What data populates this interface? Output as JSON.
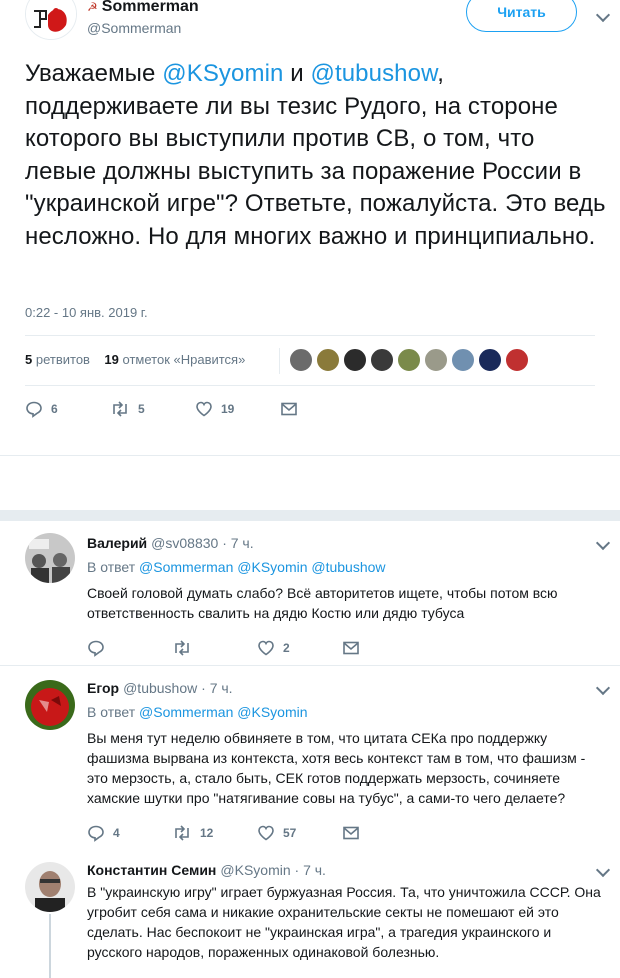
{
  "main": {
    "name": "Sommerman",
    "name_icon": "☭",
    "handle": "@Sommerman",
    "follow_label": "Читать",
    "text_parts": {
      "p1": "Уважаемые ",
      "m1": "@KSyomin",
      "p2": " и ",
      "m2": "@tubushow",
      "p3": ", поддерживаете ли вы тезис Рудого, на стороне которого вы выступили против СВ, о том, что левые должны выступить за поражение России в \"украинской игре\"? Ответьте, пожалуйста. Это ведь несложно. Но для многих важно и принципиально."
    },
    "timestamp": "0:22 - 10 янв. 2019 г.",
    "retweets_count": "5",
    "retweets_label": "ретвитов",
    "likes_count": "19",
    "likes_label": "отметок «Нравится»",
    "liker_colors": [
      "#6b6b6b",
      "#8a7a3a",
      "#2b2b2b",
      "#3a3a3a",
      "#7a8a4a",
      "#9a9a8a",
      "#7090b0",
      "#1a2a5a",
      "#c03030"
    ],
    "actions": {
      "replies": "6",
      "retweets": "5",
      "likes": "19"
    }
  },
  "replies": [
    {
      "name": "Валерий",
      "handle": "@sv08830",
      "time": "· 7 ч.",
      "in_reply_label": "В ответ",
      "in_reply_mentions": "@Sommerman @KSyomin @tubushow",
      "text": "Своей головой думать слабо? Всё авторитетов ищете, чтобы потом всю ответственность свалить на дядю Костю или дядю тубуса",
      "replies": "",
      "retweets": "",
      "likes": "2"
    },
    {
      "name": "Егор",
      "handle": "@tubushow",
      "time": "· 7 ч.",
      "in_reply_label": "В ответ",
      "in_reply_mentions": "@Sommerman @KSyomin",
      "text": "Вы меня тут неделю обвиняете в том, что цитата СЕКа про поддержку фашизма вырвана из контекста, хотя весь контекст там в том, что фашизм - это мерзость, а, стало быть, СЕК готов поддержать мерзость, сочиняете хамские шутки про \"натягивание совы на тубус\", а сами-то чего делаете?",
      "replies": "4",
      "retweets": "12",
      "likes": "57"
    },
    {
      "name": "Константин Семин",
      "handle": "@KSyomin",
      "time": "· 7 ч.",
      "text": "В \"украинскую игру\" играет буржуазная Россия. Та, что уничтожила СССР. Она угробит себя сама и никакие охранительские секты не помешают ей это сделать. Нас беспокоит не \"украинская игра\", а трагедия украинского и русского народов, пораженных одинаковой болезнью."
    }
  ]
}
